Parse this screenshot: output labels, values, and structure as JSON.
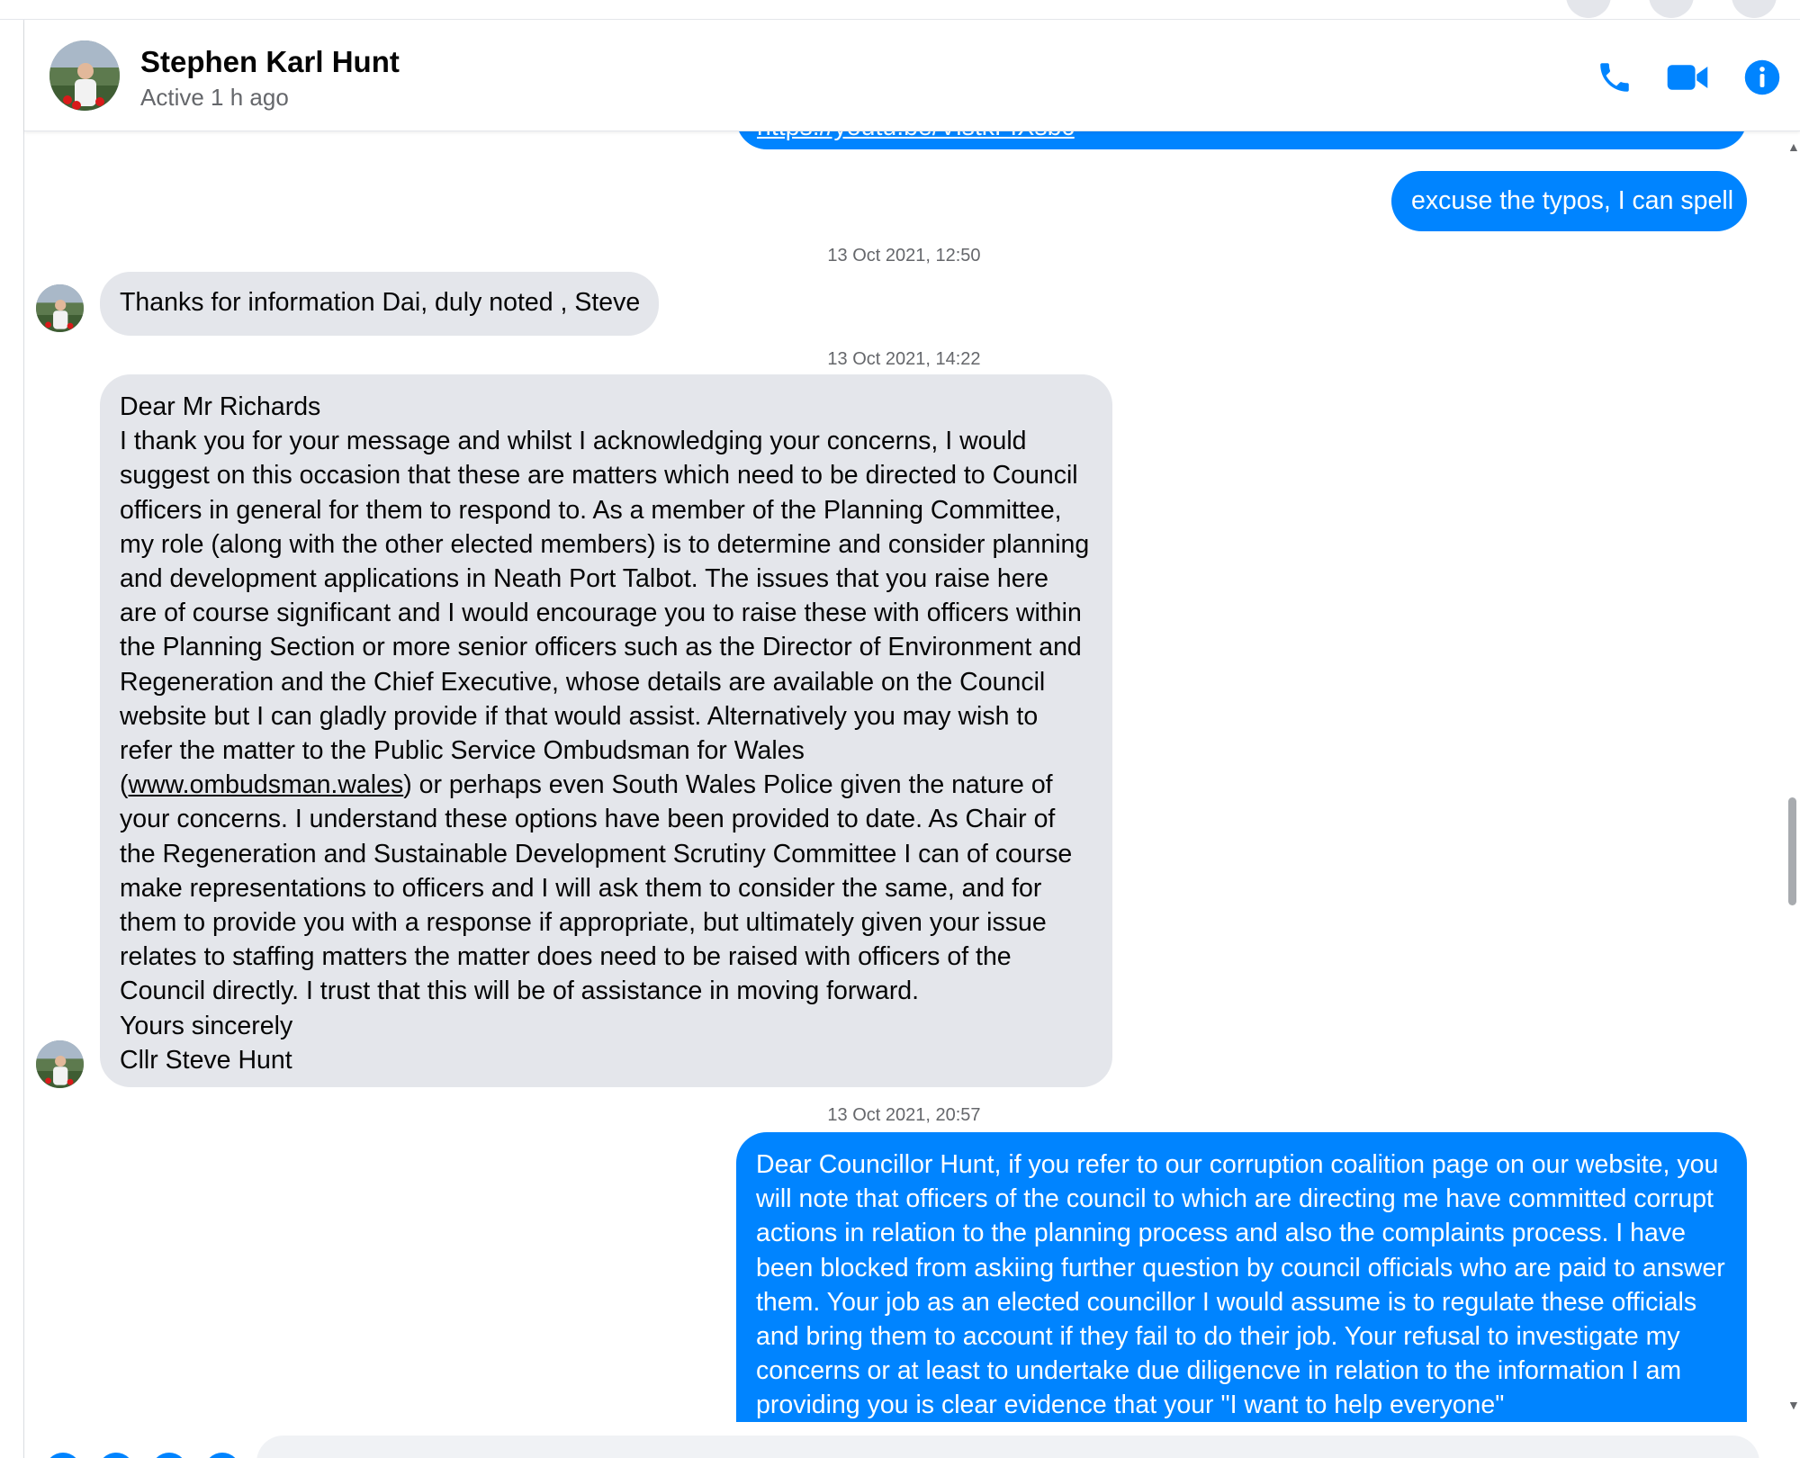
{
  "header": {
    "contact_name": "Stephen Karl Hunt",
    "status": "Active 1 h ago",
    "icons": [
      "phone-icon",
      "video-camera-icon",
      "info-icon"
    ],
    "accent_color": "#0084ff"
  },
  "messages": {
    "m0_partial_link": "https://youtu.be/VistkFfXsbc",
    "m1_text": "excuse the typos, I can spell",
    "ts1": "13 Oct 2021, 12:50",
    "m2_text": "Thanks for information Dai, duly noted , Steve",
    "ts2": "13 Oct 2021, 14:22",
    "m3": {
      "line1": "Dear Mr Richards",
      "body_before_link": "I thank you for your message and whilst I acknowledging your concerns, I would suggest on this occasion that these are matters which need to be directed to Council officers in general for them to respond to. As a member of the Planning Committee, my role (along with the other elected members) is to determine and consider planning and development applications in Neath Port Talbot. The issues that you raise here are of course significant and I would encourage you to raise these with officers within the Planning Section or more senior officers such as the Director of Environment and Regeneration and the Chief Executive, whose details are available on the Council website but I can gladly provide if that would assist. Alternatively you may wish to refer the matter to the Public Service Ombudsman for Wales (",
      "link": "www.ombudsman.wales",
      "body_after_link": ") or perhaps even South Wales Police given the nature of your concerns. I understand these options have been provided to date. As Chair of the Regeneration and Sustainable Development Scrutiny Committee I can of course make representations to officers and I will ask them to consider the same, and for them to  provide you with a response if appropriate, but ultimately given your issue relates to staffing matters the matter does need to be raised with officers of the Council directly. I trust that this will be of assistance in moving forward.",
      "closing": "Yours sincerely",
      "signature": "Cllr Steve Hunt"
    },
    "ts3": "13 Oct 2021, 20:57",
    "m4_text": "Dear Councillor Hunt, if you refer to our corruption coalition page on our website, you will note that officers of the council to which are directing me have committed corrupt actions in relation to the planning process and also the complaints process. I have been blocked from askiing further question by council officials who are paid to answer them. Your job as an elected councillor I would assume is to regulate these officials and bring them to account if they fail to do their job. Your refusal to investigate my concerns or at least to undertake due diligencve in relation to the information I am providing you is clear evidence that your \"I want to help everyone\""
  },
  "colors": {
    "incoming_bubble": "#e4e6eb",
    "outgoing_bubble": "#0084ff",
    "timestamp": "#65676b"
  }
}
